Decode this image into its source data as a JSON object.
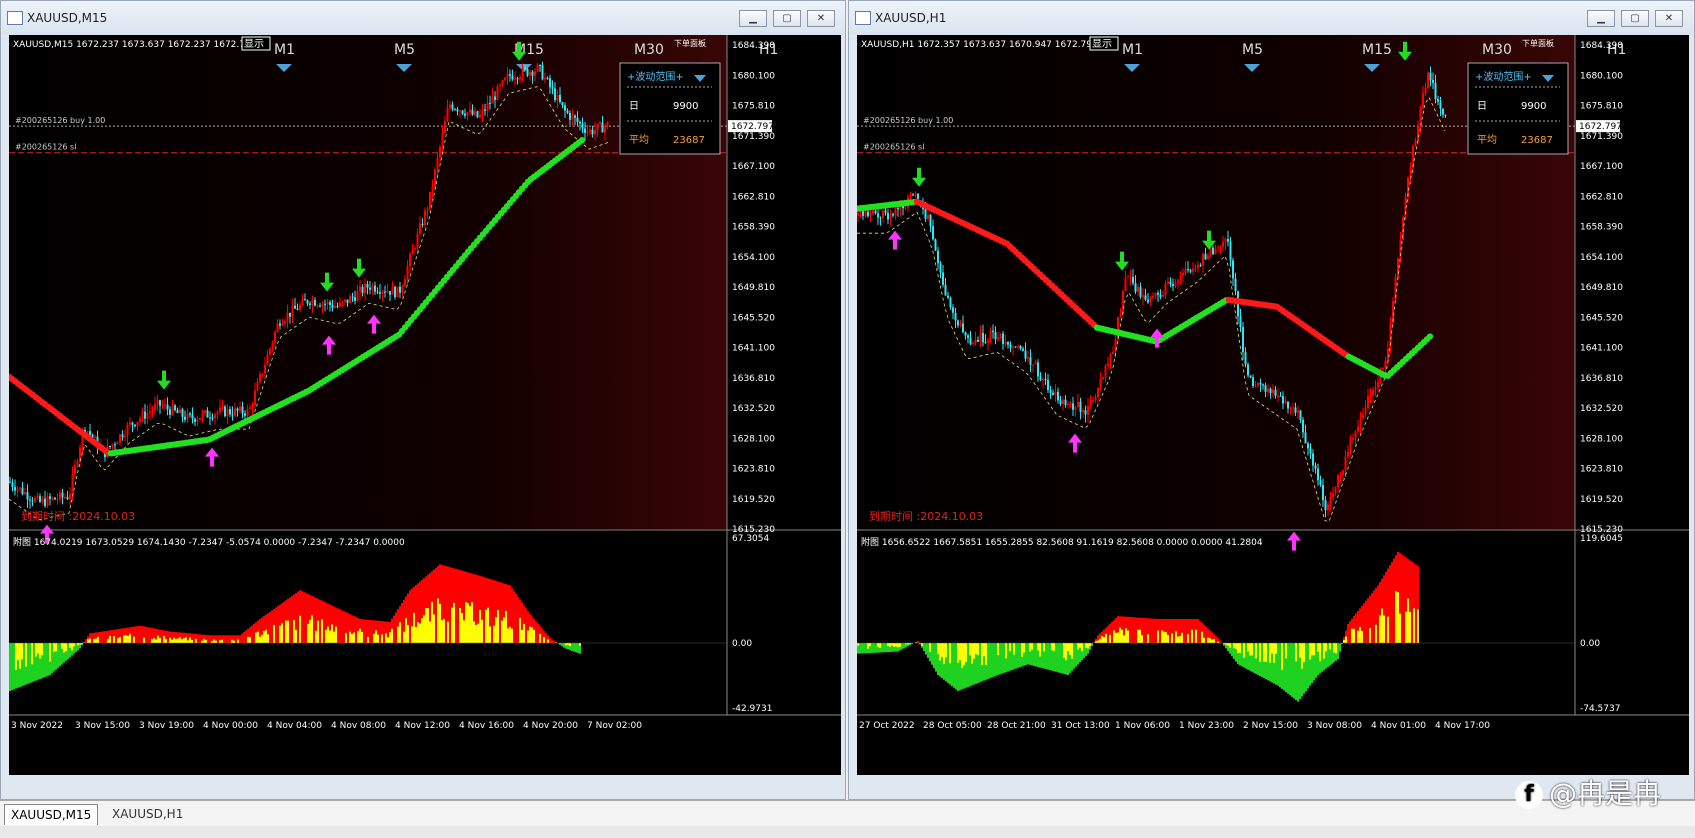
{
  "windows": [
    {
      "title": "XAUUSD,M15",
      "header": "XAUUSD,M15  1672.237 1673.637 1672.237 1672.7",
      "show_button": "显示",
      "tf_labels": [
        "M1",
        "M5",
        "M15",
        "M30",
        "H1"
      ],
      "top_right_label": "下单面板",
      "order_buy": "#200265126 buy 1.00",
      "order_sl": "#200265126 sl",
      "panel": {
        "title": "+波动范围+",
        "row1_label": "日",
        "row1_value": "9900",
        "row2_label": "平均",
        "row2_value": "23687"
      },
      "expiry": "到期时间 :2024.10.03",
      "price_axis": [
        "1684.390",
        "1680.100",
        "1675.810",
        "1671.390",
        "1667.100",
        "1662.810",
        "1658.390",
        "1654.100",
        "1649.810",
        "1645.520",
        "1641.100",
        "1636.810",
        "1632.520",
        "1628.100",
        "1623.810",
        "1619.520",
        "1615.230"
      ],
      "current_price": "1672.797",
      "sub_header": "附图 1674.0219 1673.0529 1674.1430 -7.2347 -5.0574 0.0000 -7.2347 -7.2347 0.0000",
      "sub_axis": [
        "67.3054",
        "0.00",
        "-42.9731"
      ],
      "time_axis": [
        "3 Nov 2022",
        "3 Nov 15:00",
        "3 Nov 19:00",
        "4 Nov 00:00",
        "4 Nov 04:00",
        "4 Nov 08:00",
        "4 Nov 12:00",
        "4 Nov 16:00",
        "4 Nov 20:00",
        "7 Nov 02:00"
      ]
    },
    {
      "title": "XAUUSD,H1",
      "header": "XAUUSD,H1  1672.357 1673.637 1670.947 1672.79",
      "show_button": "显示",
      "tf_labels": [
        "M1",
        "M5",
        "M15",
        "M30",
        "H1"
      ],
      "top_right_label": "下单面板",
      "order_buy": "#200265126 buy 1.00",
      "order_sl": "#200265126 sl",
      "panel": {
        "title": "+波动范围+",
        "row1_label": "日",
        "row1_value": "9900",
        "row2_label": "平均",
        "row2_value": "23687"
      },
      "expiry": "到期时间 :2024.10.03",
      "price_axis": [
        "1684.390",
        "1680.100",
        "1675.810",
        "1671.390",
        "1667.100",
        "1662.810",
        "1658.390",
        "1654.100",
        "1649.810",
        "1645.520",
        "1641.100",
        "1636.810",
        "1632.520",
        "1628.100",
        "1623.810",
        "1619.520",
        "1615.230"
      ],
      "current_price": "1672.797",
      "sub_header": "附图 1656.6522 1667.5851 1655.2855 82.5608 91.1619 82.5608 0.0000 0.0000 41.2804",
      "sub_axis": [
        "119.6045",
        "0.00",
        "-74.5737"
      ],
      "time_axis": [
        "27 Oct 2022",
        "28 Oct 05:00",
        "28 Oct 21:00",
        "31 Oct 13:00",
        "1 Nov 06:00",
        "1 Nov 23:00",
        "2 Nov 15:00",
        "3 Nov 08:00",
        "4 Nov 01:00",
        "4 Nov 17:00"
      ]
    }
  ],
  "tabs": [
    "XAUUSD,M15",
    "XAUUSD,H1"
  ],
  "watermark": "@冉是冉",
  "colors": {
    "bull": "#ff0000",
    "bear": "#33e6f2",
    "ma_up": "#22e022",
    "ma_down": "#ff1a1a",
    "hist_yellow": "#ffff00",
    "arrow_down": "#22dd22",
    "arrow_up": "#ff33ff"
  }
}
